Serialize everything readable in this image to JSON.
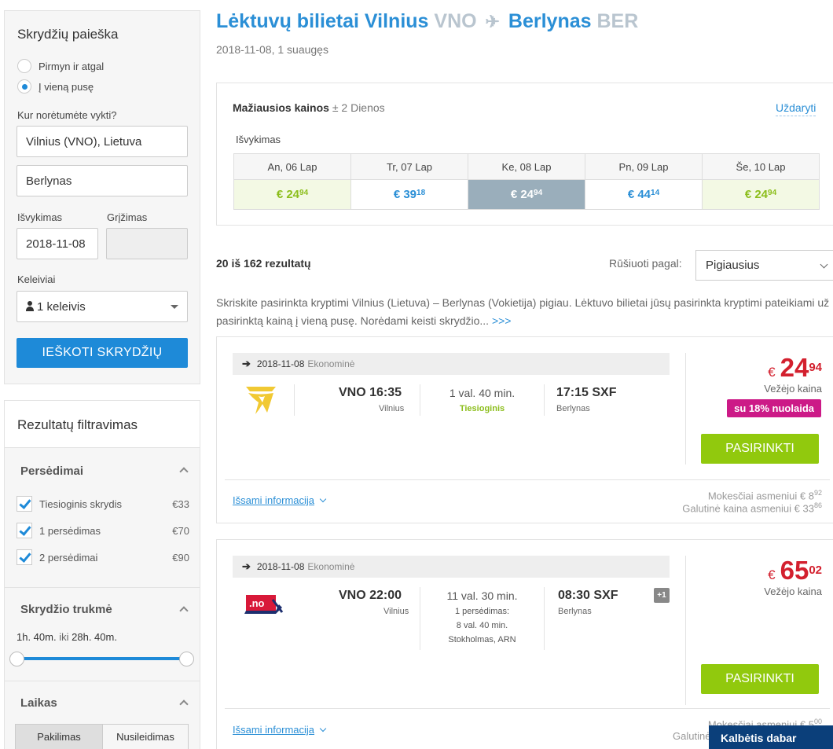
{
  "search": {
    "title": "Skrydžių paieška",
    "trip_types": [
      {
        "label": "Pirmyn ir atgal",
        "selected": false
      },
      {
        "label": "Į vieną pusę",
        "selected": true
      }
    ],
    "destination_label": "Kur norėtumėte vykti?",
    "from_value": "Vilnius (VNO), Lietuva",
    "to_value": "Berlynas",
    "departure_label": "Išvykimas",
    "return_label": "Grįžimas",
    "departure_value": "2018-11-08",
    "return_value": "",
    "passengers_label": "Keleiviai",
    "passengers_value": "1 keleivis",
    "search_button": "IEŠKOTI SKRYDŽIŲ"
  },
  "filters": {
    "title": "Rezultatų filtravimas",
    "stops_title": "Persėdimai",
    "stops": [
      {
        "label": "Tiesioginis skrydis",
        "price": "€33",
        "checked": true
      },
      {
        "label": "1 persėdimas",
        "price": "€70",
        "checked": true
      },
      {
        "label": "2 persėdimai",
        "price": "€90",
        "checked": true
      }
    ],
    "duration_title": "Skrydžio trukmė",
    "duration_min": "1h. 40m.",
    "duration_sep": "iki",
    "duration_max": "28h. 40m.",
    "time_title": "Laikas",
    "time_tabs": [
      "Pakilimas",
      "Nusileidimas"
    ]
  },
  "header": {
    "title_from": "Lėktuvų bilietai Vilnius",
    "from_code": "VNO",
    "plane_glyph": "✈",
    "title_to": "Berlynas",
    "to_code": "BER",
    "subtitle": "2018-11-08, 1 suaugęs"
  },
  "calendar": {
    "title": "Mažiausios kainos",
    "range": "± 2 Dienos",
    "close": "Uždaryti",
    "departure_label": "Išvykimas",
    "days": [
      {
        "day": "An, 06 Lap",
        "currency": "€",
        "int": "24",
        "dec": "94",
        "state": "cheap"
      },
      {
        "day": "Tr, 07 Lap",
        "currency": "€",
        "int": "39",
        "dec": "18",
        "state": "normal"
      },
      {
        "day": "Ke, 08 Lap",
        "currency": "€",
        "int": "24",
        "dec": "94",
        "state": "selected"
      },
      {
        "day": "Pn, 09 Lap",
        "currency": "€",
        "int": "44",
        "dec": "14",
        "state": "normal"
      },
      {
        "day": "Še, 10 Lap",
        "currency": "€",
        "int": "24",
        "dec": "94",
        "state": "cheap"
      }
    ]
  },
  "results": {
    "count": "20 iš 162 rezultatų",
    "sort_label": "Rūšiuoti pagal:",
    "sort_value": "Pigiausius",
    "description": "Skriskite pasirinkta kryptimi Vilnius (Lietuva) – Berlynas (Vokietija) pigiau. Lėktuvo bilietai jūsų pasirinkta kryptimi pateikiami už pasirinktą kainą į vieną pusę. Norėdami keisti skrydžio...",
    "more": ">>>"
  },
  "flights": [
    {
      "date": "2018-11-08",
      "class": "Ekonominė",
      "dep_time": "VNO 16:35",
      "dep_city": "Vilnius",
      "duration": "1 val. 40 min.",
      "stop_info": "Tiesioginis",
      "arr_time": "17:15 SXF",
      "arr_city": "Berlynas",
      "price_currency": "€",
      "price_int": "24",
      "price_dec": "94",
      "carrier_price": "Vežėjo kaina",
      "discount": "su 18% nuolaida",
      "select": "PASIRINKTI",
      "details": "Išsami informacija",
      "fee_label": "Mokesčiai asmeniui €",
      "fee_int": "8",
      "fee_dec": "92",
      "total_label": "Galutinė kaina asmeniui €",
      "total_int": "33",
      "total_dec": "86"
    },
    {
      "date": "2018-11-08",
      "class": "Ekonominė",
      "dep_time": "VNO 22:00",
      "dep_city": "Vilnius",
      "duration": "11 val. 30 min.",
      "stop_lines": [
        "1 persėdimas:",
        "8 val. 40 min.",
        "Stokholmas, ARN"
      ],
      "arr_time": "08:30 SXF",
      "arr_city": "Berlynas",
      "plus_day": "+1",
      "price_currency": "€",
      "price_int": "65",
      "price_dec": "02",
      "carrier_price": "Vežėjo kaina",
      "select": "PASIRINKTI",
      "details": "Išsami informacija",
      "fee_label": "Mokesčiai asmeniui €",
      "fee_int": "5",
      "fee_dec": "00",
      "total_label": "Galutinė"
    }
  ],
  "chat": "Kalbėtis dabar",
  "colors": {
    "brand_blue": "#2b8fd6",
    "button_green": "#91c90d",
    "price_red": "#d3202e",
    "discount_pink": "#cc1a87",
    "chat_navy": "#0b3f7a"
  }
}
